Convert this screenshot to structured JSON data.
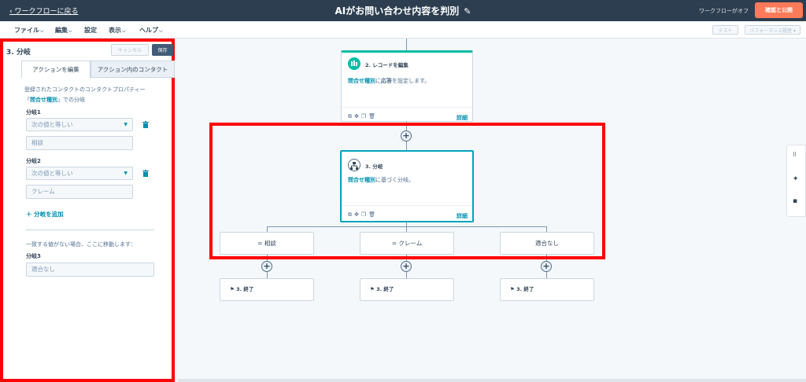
{
  "topbar": {
    "back_link": "‹ ワークフローに戻る",
    "title": "AIがお問い合わせ内容を判別",
    "workflow_status": "ワークフローがオフ",
    "publish_button": "確認と公開"
  },
  "menu": {
    "items": [
      "ファイル",
      "編集",
      "設定",
      "表示",
      "ヘルプ"
    ],
    "test_button": "テスト",
    "performance_button": "パフォーマンス履歴 ▾"
  },
  "panel": {
    "title": "3. 分岐",
    "cancel": "キャンセル",
    "save": "保存",
    "tabs": [
      "アクションを編集",
      "アクション内のコンタクト"
    ],
    "desc_prefix": "登録されたコンタクトのコンタクトプロパティー「",
    "desc_link": "問合せ種別",
    "desc_suffix": "」での分岐",
    "branches": [
      {
        "label": "分岐1",
        "operator": "次の値と等しい",
        "value": "相談"
      },
      {
        "label": "分岐2",
        "operator": "次の値と等しい",
        "value": "クレーム"
      }
    ],
    "add_branch": "分岐を追加",
    "no_match_note": "一致する値がない場合、ここに移動します：",
    "branch3_label": "分岐3",
    "branch3_value": "適合なし"
  },
  "canvas": {
    "card1": {
      "title": "2. レコードを編集",
      "body_link": "問合せ種別",
      "body_mid": "に",
      "body_bold": "応答",
      "body_suffix": "を設定します。",
      "details": "詳細"
    },
    "card2": {
      "title": "3. 分岐",
      "body_link": "問合せ種別",
      "body_suffix": "に基づく分岐。",
      "details": "詳細"
    },
    "branches": [
      "= 相談",
      "= クレーム",
      "適合なし"
    ],
    "ends": [
      "3. 終了",
      "3. 終了",
      "3. 終了"
    ]
  },
  "colors": {
    "topbar": "#2d3e50",
    "accent_orange": "#ff7a59",
    "teal": "#00bda5",
    "link": "#0091ae",
    "highlight_red": "#ff0000"
  }
}
